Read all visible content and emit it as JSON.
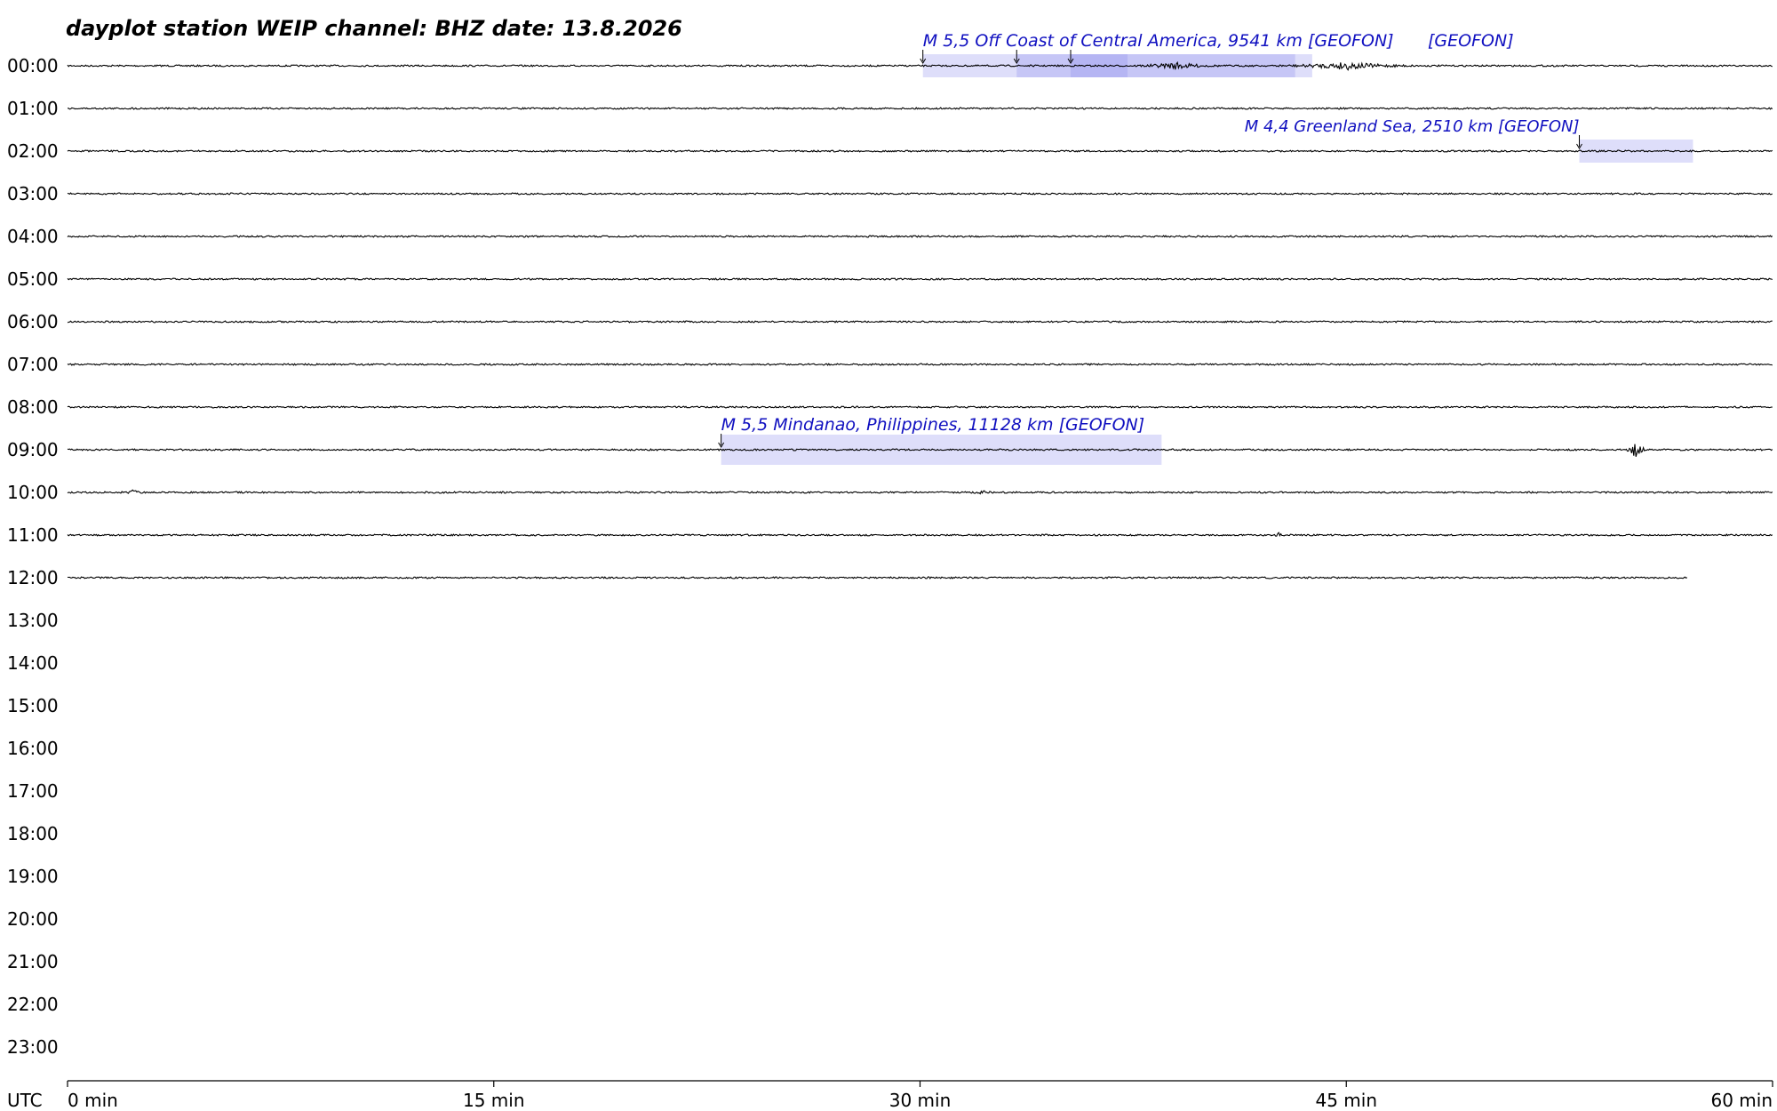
{
  "header": {
    "title": "dayplot station WEIP    channel: BHZ   date: 13.8.2026"
  },
  "colors": {
    "trace": "#000000",
    "event_box": "#8888ee",
    "event_text": "#1010c0",
    "background": "#ffffff"
  },
  "chart_data": {
    "type": "line",
    "title": "dayplot station WEIP    channel: BHZ   date: 13.8.2026",
    "station": "WEIP",
    "channel": "BHZ",
    "date": "13.8.2026",
    "xlabel": "",
    "ylabel": "UTC",
    "x_unit": "min",
    "xlim": [
      0,
      60
    ],
    "x_ticks": [
      0,
      15,
      30,
      45,
      60
    ],
    "x_tick_labels": [
      "0 min",
      "15 min",
      "30 min",
      "45 min",
      "60 min"
    ],
    "y_axis_title": "UTC",
    "hour_labels": [
      "00:00",
      "01:00",
      "02:00",
      "03:00",
      "04:00",
      "05:00",
      "06:00",
      "07:00",
      "08:00",
      "09:00",
      "10:00",
      "11:00",
      "12:00",
      "13:00",
      "14:00",
      "15:00",
      "16:00",
      "17:00",
      "18:00",
      "19:00",
      "20:00",
      "21:00",
      "22:00",
      "23:00"
    ],
    "traces": [
      {
        "hour": 0,
        "start_min": 0,
        "end_min": 60,
        "bursts": [
          {
            "t": 39.0,
            "amp": 0.25,
            "dur": 1.5
          },
          {
            "t": 45.0,
            "amp": 0.3,
            "dur": 2.5
          }
        ]
      },
      {
        "hour": 1,
        "start_min": 0,
        "end_min": 60,
        "bursts": []
      },
      {
        "hour": 2,
        "start_min": 0,
        "end_min": 60,
        "bursts": []
      },
      {
        "hour": 3,
        "start_min": 0,
        "end_min": 60,
        "bursts": []
      },
      {
        "hour": 4,
        "start_min": 0,
        "end_min": 60,
        "bursts": []
      },
      {
        "hour": 5,
        "start_min": 0,
        "end_min": 60,
        "bursts": []
      },
      {
        "hour": 6,
        "start_min": 0,
        "end_min": 60,
        "bursts": []
      },
      {
        "hour": 7,
        "start_min": 0,
        "end_min": 60,
        "bursts": []
      },
      {
        "hour": 8,
        "start_min": 0,
        "end_min": 60,
        "bursts": []
      },
      {
        "hour": 9,
        "start_min": 0,
        "end_min": 60,
        "bursts": [
          {
            "t": 55.2,
            "amp": 1.0,
            "dur": 0.35
          }
        ]
      },
      {
        "hour": 10,
        "start_min": 0,
        "end_min": 60,
        "bursts": [
          {
            "t": 2.3,
            "amp": 0.15,
            "dur": 0.4
          },
          {
            "t": 32.2,
            "amp": 0.2,
            "dur": 0.3
          }
        ]
      },
      {
        "hour": 11,
        "start_min": 0,
        "end_min": 60,
        "bursts": [
          {
            "t": 42.6,
            "amp": 0.25,
            "dur": 0.15
          }
        ]
      },
      {
        "hour": 12,
        "start_min": 0,
        "end_min": 57.0,
        "bursts": []
      }
    ],
    "events": [
      {
        "hour": 0,
        "label": "M 5,5 Off Coast of Central America, 9541 km  [GEOFON]",
        "arrival_min": 30.1,
        "box_end_min": 43.2
      },
      {
        "hour": 0,
        "label": "",
        "arrival_min": 33.4,
        "box_end_min": 43.8
      },
      {
        "hour": 0,
        "label": "[GEOFON]",
        "arrival_min": 35.3,
        "box_end_min": 37.3
      },
      {
        "hour": 2,
        "label": "M 4,4 Greenland Sea, 2510 km  [GEOFON]",
        "arrival_min": 53.2,
        "box_end_min": 57.2
      },
      {
        "hour": 9,
        "label": "M 5,5 Mindanao, Philippines, 11128 km  [GEOFON]",
        "arrival_min": 23.0,
        "box_end_min": 38.5
      }
    ]
  }
}
